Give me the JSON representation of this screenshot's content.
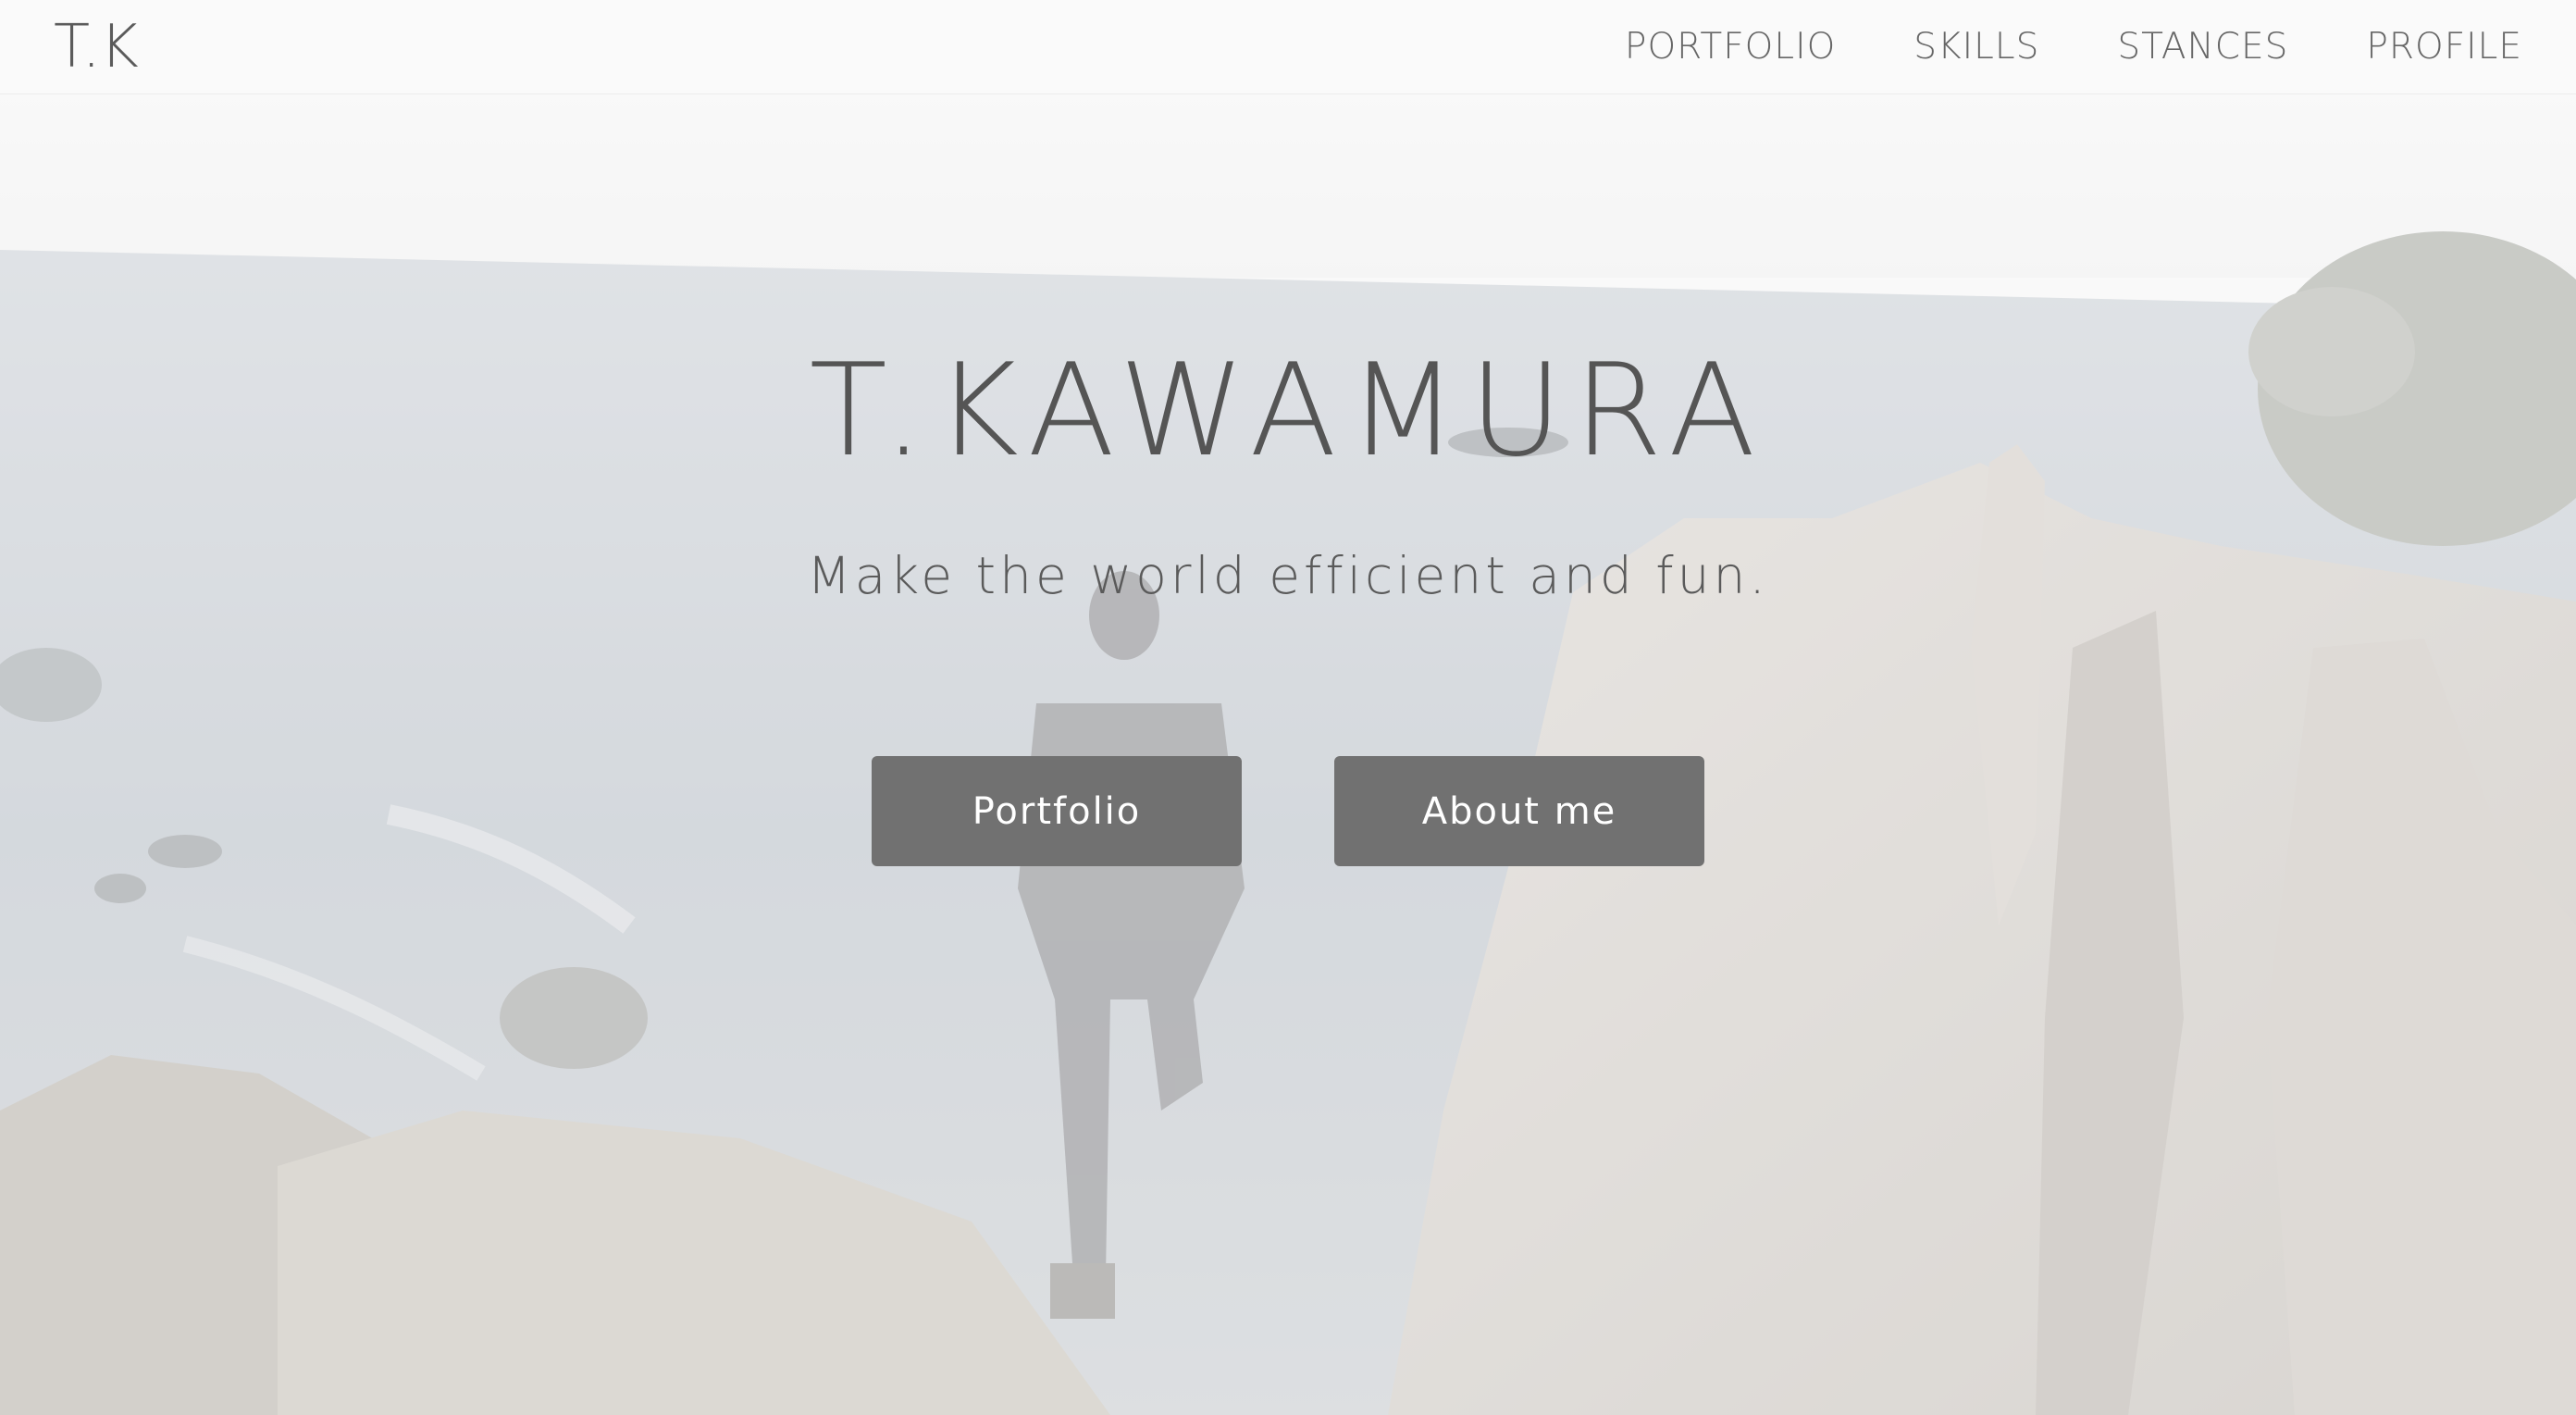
{
  "navbar": {
    "brand": "T.K",
    "links": [
      "PORTFOLIO",
      "SKILLS",
      "STANCES",
      "PROFILE"
    ]
  },
  "hero": {
    "title": "T.KAWAMURA",
    "subtitle": "Make the world efficient and fun.",
    "buttons": [
      "Portfolio",
      "About me"
    ]
  },
  "colors": {
    "button_bg": "#717171",
    "text_dark": "#555555"
  }
}
